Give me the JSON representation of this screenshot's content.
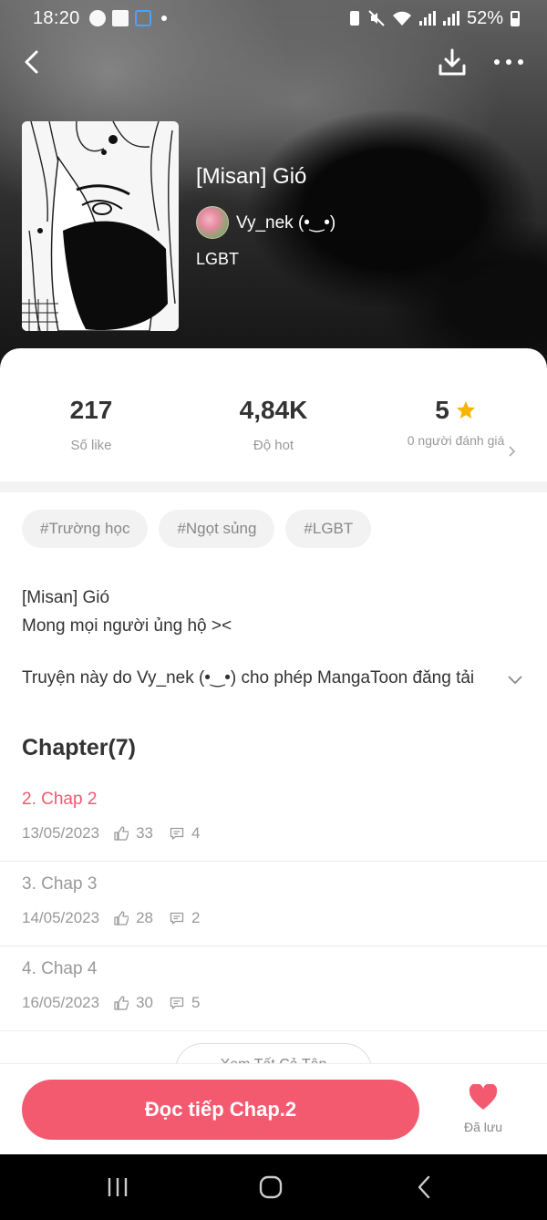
{
  "status_bar": {
    "time": "18:20",
    "battery": "52%"
  },
  "book": {
    "title": "[Misan] Gió",
    "author": "Vy_nek (•‿•)",
    "genre": "LGBT"
  },
  "stats": {
    "likes": {
      "value": "217",
      "label": "Số like"
    },
    "hot": {
      "value": "4,84K",
      "label": "Độ hot"
    },
    "rating": {
      "value": "5",
      "label": "0 người đánh giá"
    }
  },
  "tags": [
    "#Trường học",
    "#Ngọt sủng",
    "#LGBT"
  ],
  "description": {
    "line1": "[Misan] Gió",
    "line2": "Mong mọi người ủng hộ ><",
    "permission": "Truyện này do Vy_nek (•‿•) cho phép MangaToon đăng tải"
  },
  "chapters_heading": "Chapter(7)",
  "chapters": [
    {
      "title": "2. Chap 2",
      "date": "13/05/2023",
      "likes": "33",
      "comments": "4",
      "current": true
    },
    {
      "title": "3. Chap 3",
      "date": "14/05/2023",
      "likes": "28",
      "comments": "2",
      "current": false
    },
    {
      "title": "4. Chap 4",
      "date": "16/05/2023",
      "likes": "30",
      "comments": "5",
      "current": false
    }
  ],
  "view_all_label": "Xem Tất Cả Tập",
  "bottom": {
    "read_button": "Đọc tiếp Chap.2",
    "saved_label": "Đã lưu"
  },
  "colors": {
    "accent": "#f35a70",
    "current_chapter": "#f0586e",
    "star": "#f7b500"
  }
}
